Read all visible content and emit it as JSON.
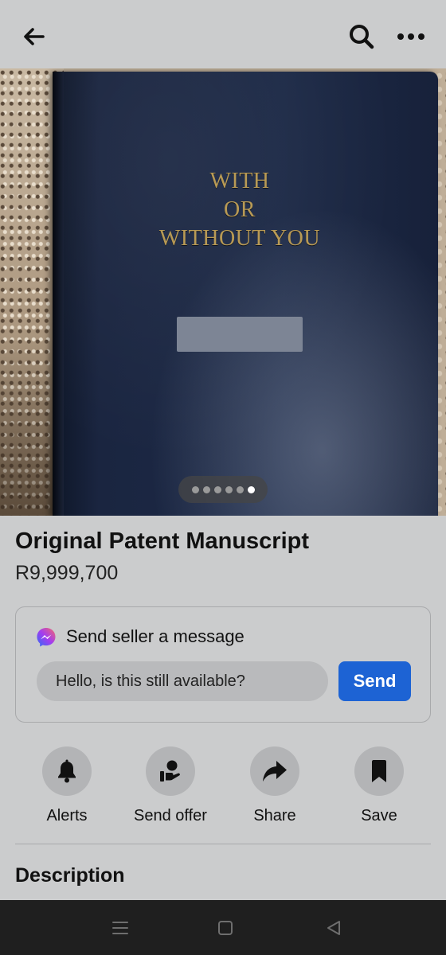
{
  "header": {
    "back_icon": "arrow-left-icon",
    "search_icon": "search-icon",
    "more_icon": "more-dots-icon"
  },
  "photo": {
    "book_title_lines": [
      "WITH",
      "OR",
      "WITHOUT YOU"
    ],
    "image_count": 6,
    "active_image": 6
  },
  "listing": {
    "title": "Original Patent Manuscript",
    "price": "R9,999,700"
  },
  "message": {
    "heading": "Send seller a message",
    "input_value": "Hello, is this still available?",
    "send_label": "Send",
    "send_color": "#1d63d4"
  },
  "actions": [
    {
      "label": "Alerts",
      "icon": "bell-icon"
    },
    {
      "label": "Send offer",
      "icon": "offer-hand-icon"
    },
    {
      "label": "Share",
      "icon": "share-arrow-icon"
    },
    {
      "label": "Save",
      "icon": "bookmark-icon"
    }
  ],
  "description": {
    "heading": "Description"
  },
  "system_nav": {
    "icons": [
      "menu-icon",
      "home-square-icon",
      "back-triangle-icon"
    ]
  }
}
